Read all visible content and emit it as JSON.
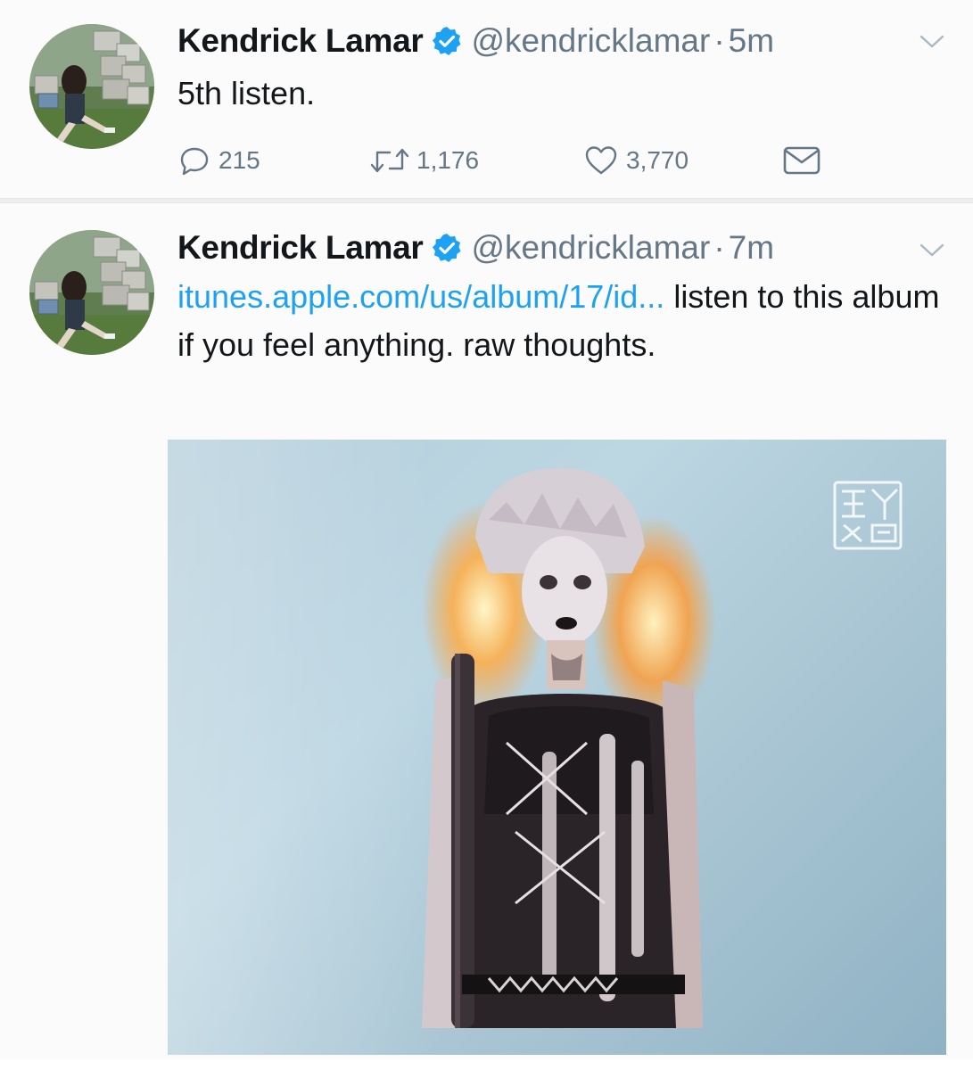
{
  "colors": {
    "link": "#1da1f2",
    "muted": "#657786",
    "text": "#14171a",
    "verified": "#1da1f2"
  },
  "tweets": [
    {
      "name": "Kendrick Lamar",
      "handle": "@kendricklamar",
      "separator": "·",
      "time": "5m",
      "text": "5th listen.",
      "actions": {
        "reply_icon": "reply-icon",
        "reply_count": "215",
        "retweet_icon": "retweet-icon",
        "retweet_count": "1,176",
        "like_icon": "heart-icon",
        "like_count": "3,770",
        "dm_icon": "envelope-icon"
      }
    },
    {
      "name": "Kendrick Lamar",
      "handle": "@kendricklamar",
      "separator": "·",
      "time": "7m",
      "link": "itunes.apple.com/us/album/17/id...",
      "text": " listen to this album if you feel anything. raw thoughts.",
      "media": {
        "watermark_icon": "chinese-seal-watermark"
      }
    }
  ]
}
